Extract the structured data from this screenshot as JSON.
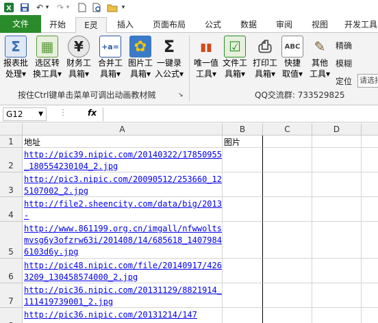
{
  "qat": {
    "dropdown_glyph": "▾"
  },
  "tabs": [
    {
      "label": "文件"
    },
    {
      "label": "开始"
    },
    {
      "label": "E灵"
    },
    {
      "label": "插入"
    },
    {
      "label": "页面布局"
    },
    {
      "label": "公式"
    },
    {
      "label": "数据"
    },
    {
      "label": "审阅"
    },
    {
      "label": "视图"
    },
    {
      "label": "开发工具"
    }
  ],
  "ribbon": {
    "buttons": [
      {
        "name": "report-batch-button",
        "icon": "Σ",
        "l1": "报表批",
        "l2": "处理▾",
        "color": "#3a6fb0"
      },
      {
        "name": "select-area-convert-button",
        "icon": "▦",
        "l1": "选区转",
        "l2": "换工具▾",
        "color": "#5a9a3a"
      },
      {
        "name": "finance-tools-button",
        "icon": "¥",
        "l1": "财务工",
        "l2": "具箱▾",
        "color": "#333333"
      },
      {
        "name": "merge-tools-button",
        "icon": "+a=",
        "l1": "合并工",
        "l2": "具箱▾",
        "color": "#2a5aa0"
      },
      {
        "name": "picture-tools-button",
        "icon": "✿",
        "l1": "图片工",
        "l2": "具箱▾",
        "color": "#e0a800"
      },
      {
        "name": "one-key-input-button",
        "icon": "Σ",
        "l1": "一键录",
        "l2": "入公式▾",
        "color": "#222222"
      },
      {
        "name": "unique-value-tools-button",
        "icon": "▮▮",
        "l1": "唯一值",
        "l2": "工具▾",
        "color": "#d04a1a"
      },
      {
        "name": "file-tools-button",
        "icon": "☑",
        "l1": "文件工",
        "l2": "具箱▾",
        "color": "#2a8b2a"
      },
      {
        "name": "print-tools-button",
        "icon": "⎙",
        "l1": "打印工",
        "l2": "具箱▾",
        "color": "#555555"
      },
      {
        "name": "quick-value-button",
        "icon": "ABC",
        "l1": "快捷",
        "l2": "取值▾",
        "color": "#444444"
      },
      {
        "name": "other-tools-button",
        "icon": "✎",
        "l1": "其他",
        "l2": "工具▾",
        "color": "#7a5a2a"
      }
    ],
    "group1_label": "按住Ctrl键单击菜单可调出动画教材贼",
    "group2_label": "QQ交流群: 733529825",
    "side_items": [
      "精确",
      "模糊",
      "定位"
    ],
    "side_input_placeholder": "请选择"
  },
  "formula_bar": {
    "name_box": "G12",
    "fx_label": "fx",
    "value": ""
  },
  "grid": {
    "columns": [
      "A",
      "B",
      "C",
      "D"
    ],
    "header_row": {
      "row": "1",
      "a": "地址",
      "b": "图片"
    },
    "rows": [
      {
        "row": "2",
        "url": "http://pic39.nipic.com/20140322/17850955_180554230104_2.jpg"
      },
      {
        "row": "3",
        "url": "http://pic3.nipic.com/20090512/253660_125107002_2.jpg"
      },
      {
        "row": "4",
        "url": "http://file2.sheencity.com/data/big/2013-"
      },
      {
        "row": "5",
        "url": "http://www.861199.org.cn/imgall/nfwwoltsmvsg6y3ofzrw63i/201408/14/685618_14079846103d6y.jpg"
      },
      {
        "row": "6",
        "url": "http://pic48.nipic.com/file/20140917/4263209_130458574000_2.jpg"
      },
      {
        "row": "7",
        "url": "http://pic36.nipic.com/20131129/8821914_111419739001_2.jpg"
      },
      {
        "row": "8",
        "url": "http://pic36.nipic.com/20131214/147"
      }
    ]
  },
  "colors": {
    "file_tab": "#2a8b2a",
    "link": "#0000ee",
    "ribbon_bg": "#f3f3f3"
  }
}
